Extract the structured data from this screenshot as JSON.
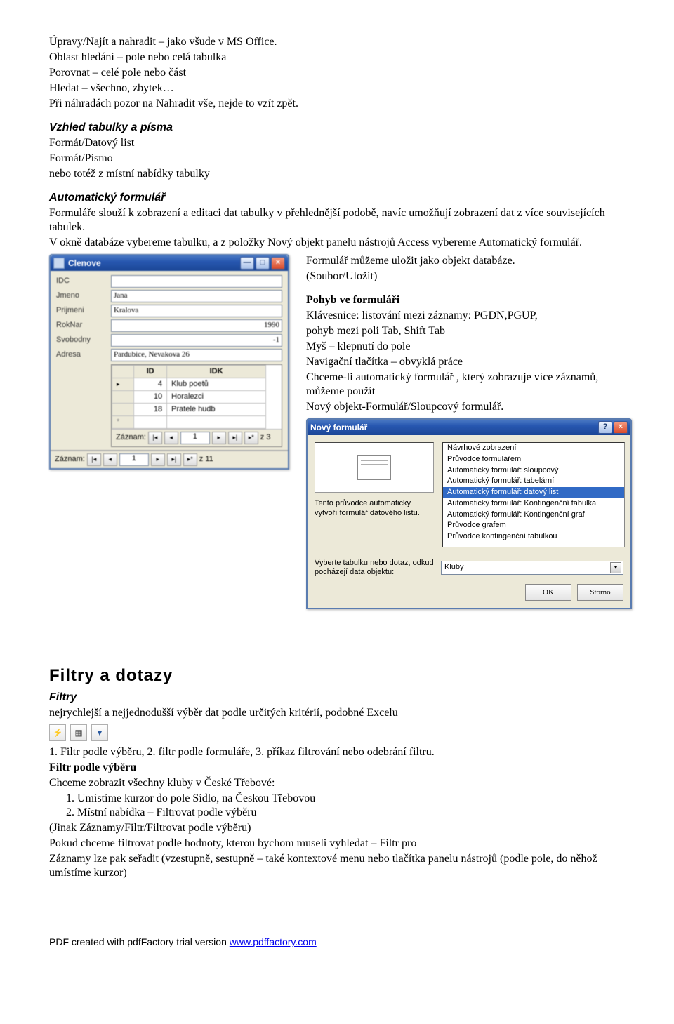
{
  "intro": {
    "l1": "Úpravy/Najít a nahradit – jako všude v MS Office.",
    "l2": "Oblast hledání – pole nebo celá tabulka",
    "l3": "Porovnat – celé pole nebo část",
    "l4": "Hledat – všechno, zbytek…",
    "l5": "Při náhradách pozor na Nahradit vše, nejde to vzít zpět."
  },
  "vzhled": {
    "h": "Vzhled tabulky a písma",
    "l1": "Formát/Datový list",
    "l2": "Formát/Písmo",
    "l3": "nebo totéž z místní nabídky tabulky"
  },
  "autoform": {
    "h": "Automatický formulář",
    "p1": "Formuláře slouží k zobrazení a editaci dat tabulky v přehlednější podobě, navíc umožňují zobrazení dat z více souvisejících tabulek.",
    "p2": "V okně databáze vybereme tabulku, a z položky Nový objekt  panelu nástrojů Access vybereme Automatický formulář."
  },
  "formWindow": {
    "title": "Clenove",
    "labels": {
      "idc": "IDC",
      "jmeno": "Jmeno",
      "prijmeni": "Prijmeni",
      "roknar": "RokNar",
      "svobodny": "Svobodny",
      "adresa": "Adresa"
    },
    "values": {
      "idc": "",
      "jmeno": "Jana",
      "prijmeni": "Kralova",
      "roknar": "1990",
      "svobodny": "-1",
      "adresa": "Pardubice, Nevakova 26"
    },
    "sub": {
      "headers": {
        "id": "ID",
        "idk": "IDK"
      },
      "rows": [
        {
          "id": "4",
          "idk": "Klub poetů"
        },
        {
          "id": "10",
          "idk": "Horalezci"
        },
        {
          "id": "18",
          "idk": "Pratele hudb"
        }
      ]
    },
    "nav": {
      "label": "Záznam:",
      "current": "1",
      "total": "z 3",
      "nav2": "z 11"
    }
  },
  "rightCol": {
    "l1": "Formulář můžeme uložit jako objekt databáze.",
    "l2": "(Soubor/Uložit)",
    "h": "Pohyb ve formuláři",
    "l3": "Klávesnice: listování mezi záznamy: PGDN,PGUP,",
    "l4": "pohyb mezi poli Tab, Shift Tab",
    "l5": "Myš – klepnutí do pole",
    "l6": "Navigační tlačítka – obvyklá práce",
    "l7": "Chceme-li automatický formulář , který zobrazuje více záznamů, můžeme použít",
    "l8": "Nový objekt-Formulář/Sloupcový formulář."
  },
  "wizard": {
    "title": "Nový formulář",
    "desc": "Tento průvodce automaticky vytvoří formulář datového listu.",
    "list": [
      "Návrhové zobrazení",
      "Průvodce formulářem",
      "Automatický formulář: sloupcový",
      "Automatický formulář: tabelární",
      "Automatický formulář: datový list",
      "Automatický formulář: Kontingenční tabulka",
      "Automatický formulář: Kontingenční graf",
      "Průvodce grafem",
      "Průvodce kontingenční tabulkou"
    ],
    "selectedIndex": 4,
    "lowerLabel": "Vyberte tabulku nebo dotaz, odkud pocházejí data objektu:",
    "comboValue": "Kluby",
    "ok": "OK",
    "cancel": "Storno"
  },
  "filters": {
    "h": "Filtry a dotazy",
    "sub": "Filtry",
    "p1": "nejrychlejší a nejjednodušší výběr dat  podle určitých kritérií, podobné Excelu",
    "p2": "1. Filtr podle výběru, 2. filtr podle formuláře, 3. příkaz filtrování nebo odebrání filtru.",
    "b1": "Filtr podle výběru",
    "p3": "Chceme zobrazit všechny kluby v České Třebové:",
    "li1": "Umístíme kurzor do pole Sídlo, na Českou Třebovou",
    "li2": "Místní nabídka – Filtrovat podle výběru",
    "p4": " (Jinak Záznamy/Filtr/Filtrovat podle výběru)",
    "p5": "Pokud chceme filtrovat podle hodnoty, kterou bychom museli vyhledat – Filtr pro",
    "p6": "Záznamy lze pak seřadit (vzestupně, sestupně – také kontextové menu nebo tlačítka panelu nástrojů (podle pole, do něhož umístíme kurzor)"
  },
  "footer": {
    "prefix": "PDF created with pdfFactory trial version ",
    "link": "www.pdffactory.com"
  }
}
